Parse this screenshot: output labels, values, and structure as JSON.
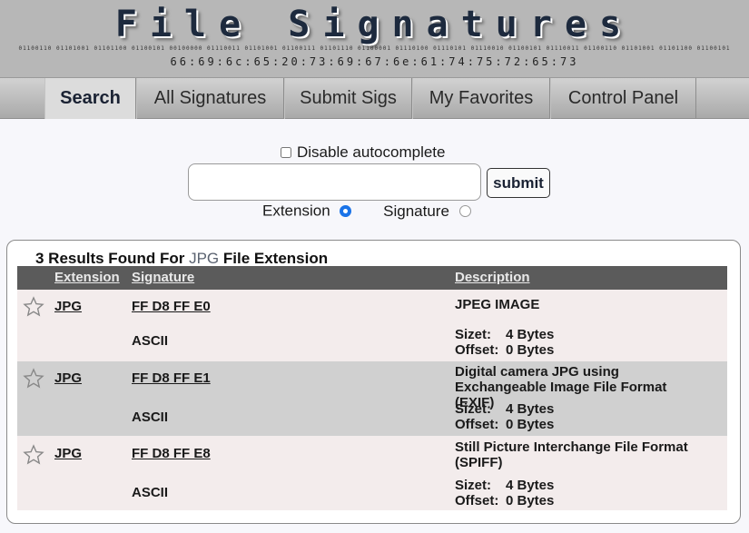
{
  "header": {
    "logo_text": "File Signatures",
    "binary_line": "01100110 01101001 01101100 01100101 00100000 01110011 01101001 01100111 01101110 01100001 01110100 01110101 01110010 01100101 01110011 01100110 01101001 01101100 01100101",
    "hex_line": "66:69:6c:65:20:73:69:67:6e:61:74:75:72:65:73"
  },
  "nav": {
    "tabs": [
      {
        "label": "Search",
        "active": true
      },
      {
        "label": "All Signatures",
        "active": false
      },
      {
        "label": "Submit Sigs",
        "active": false
      },
      {
        "label": "My Favorites",
        "active": false
      },
      {
        "label": "Control Panel",
        "active": false
      }
    ]
  },
  "search": {
    "autocomplete_label": "Disable autocomplete",
    "autocomplete_checked": false,
    "input_value": "",
    "submit_label": "submit",
    "radio_extension_label": "Extension",
    "radio_signature_label": "Signature",
    "selected_mode": "Extension"
  },
  "results": {
    "title_prefix": "3 Results Found For",
    "query": "JPG",
    "title_suffix": "File Extension",
    "columns": {
      "extension": "Extension",
      "signature": "Signature",
      "description": "Description"
    },
    "rows": [
      {
        "extension": "JPG",
        "signature": "FF D8 FF E0",
        "ascii": "ASCII",
        "description": "JPEG IMAGE",
        "size_label": "Sizet:",
        "size_value": "4 Bytes",
        "offset_label": "Offset:",
        "offset_value": "0 Bytes"
      },
      {
        "extension": "JPG",
        "signature": "FF D8 FF E1",
        "ascii": "ASCII",
        "description": "Digital camera JPG using Exchangeable Image File Format (EXIF)",
        "size_label": "Sizet:",
        "size_value": "4 Bytes",
        "offset_label": "Offset:",
        "offset_value": "0 Bytes"
      },
      {
        "extension": "JPG",
        "signature": "FF D8 FF E8",
        "ascii": "ASCII",
        "description": "Still Picture Interchange File Format (SPIFF)",
        "size_label": "Sizet:",
        "size_value": "4 Bytes",
        "offset_label": "Offset:",
        "offset_value": "0 Bytes"
      }
    ]
  },
  "colors": {
    "header_bg": "#b7b7b7",
    "logo_text": "#1d2a3e",
    "table_header_bg": "#5b5b5b",
    "row_light": "#f3ecec",
    "row_dark": "#d0d0d0",
    "radio_accent": "#1a73e8"
  },
  "icons": {
    "favorite": "star-outline-icon"
  }
}
